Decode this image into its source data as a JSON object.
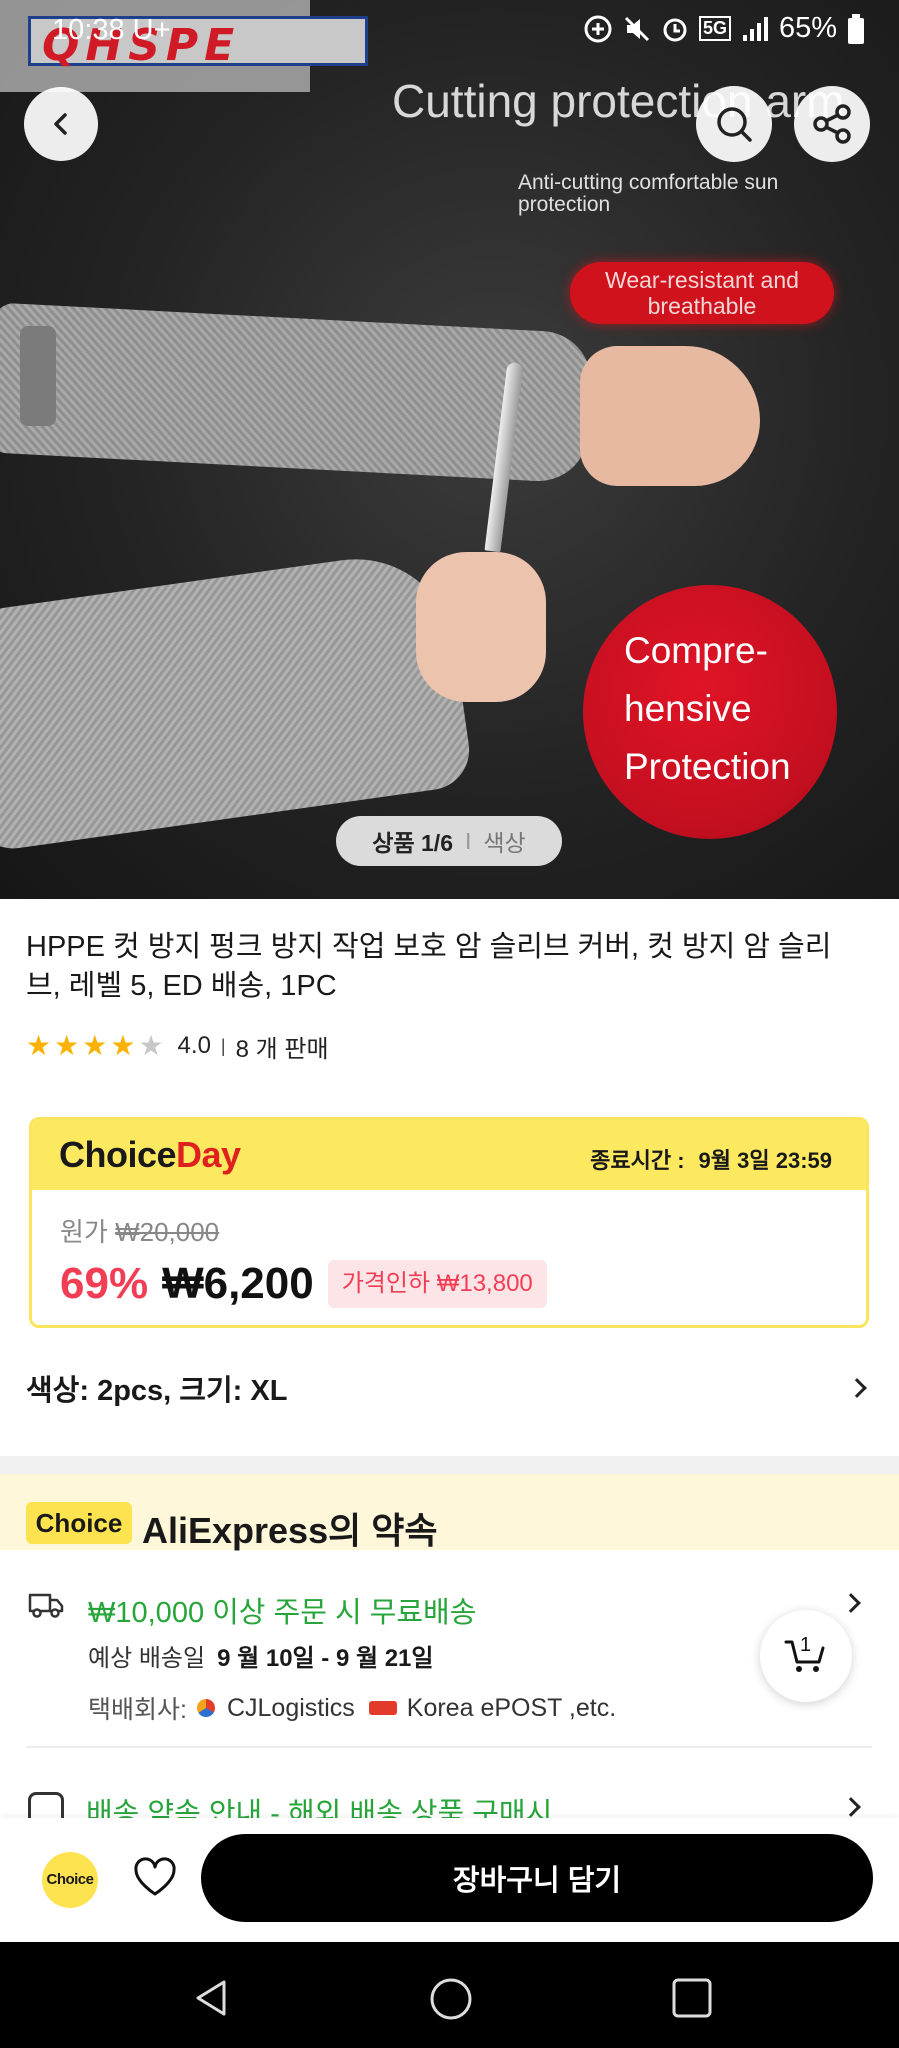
{
  "status_bar": {
    "time": "10:38",
    "carrier": "U+",
    "battery": "65%",
    "network": "5G"
  },
  "hero": {
    "brand_logo": "QHSPE",
    "heading": "Cutting protection arm",
    "subheading": "Anti-cutting comfortable sun protection",
    "pill_text": "Wear-resistant and breathable",
    "circle_text": "Compre-hensive Protection",
    "counter_num": "상품 1/6",
    "counter_sep": "I",
    "counter_opt": "색상"
  },
  "product": {
    "title": "HPPE 컷 방지 펑크 방지 작업 보호 암 슬리브 커버, 컷 방지 암 슬리브, 레벨 5, ED 배송, 1PC",
    "rating": "4.0",
    "rating_stars": 4,
    "sold": "8 개 판매"
  },
  "choice_day": {
    "logo_a": "Choice",
    "logo_b": "Day",
    "end_label": "종료시간 :",
    "end_time": "9월 3일 23:59",
    "orig_label": "원가",
    "orig_price": "₩20,000",
    "discount_pct": "69%",
    "price": "₩6,200",
    "price_drop": "가격인하 ₩13,800"
  },
  "variant": {
    "text": "색상: 2pcs, 크기: XL"
  },
  "promise": {
    "tag": "Choice",
    "title": "AliExpress의 약속",
    "free_shipping": "₩10,000 이상 주문 시 무료배송",
    "eta_label": "예상 배송일",
    "eta_dates": "9 월 10일 - 9 월 21일",
    "carrier_label": "택배회사:",
    "carrier_1": "CJLogistics",
    "carrier_2": "Korea ePOST ,etc.",
    "policy": "배송 약속 안내 - 해외 배송 상품 구매시"
  },
  "cart_float": {
    "count": "1"
  },
  "bottom": {
    "choice_badge": "Choice",
    "add_to_cart": "장바구니 담기"
  },
  "colors": {
    "accent_red": "#f23e55",
    "choice_yellow": "#fde960",
    "free_green": "#27a53b"
  },
  "icons": [
    "back-icon",
    "search-icon",
    "share-icon",
    "truck-icon",
    "cart-icon",
    "heart-icon",
    "nav-back-icon",
    "nav-home-icon",
    "nav-recents-icon"
  ]
}
